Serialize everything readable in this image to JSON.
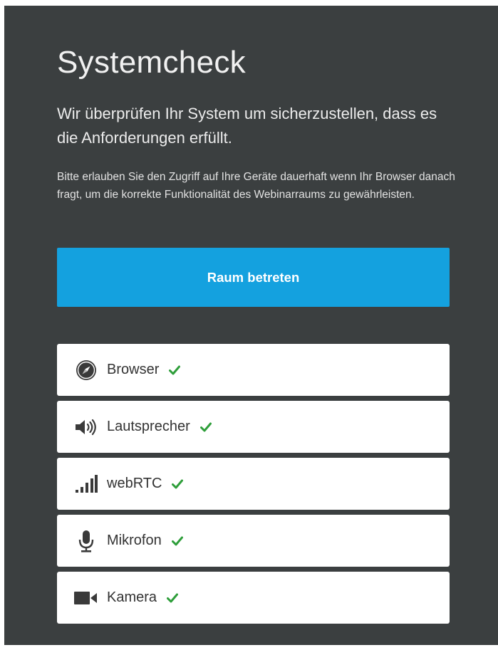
{
  "page": {
    "title": "Systemcheck",
    "subtitle": "Wir überprüfen Ihr System um sicherzustellen, dass es die Anforderungen erfüllt.",
    "note": "Bitte erlauben Sie den Zugriff auf Ihre Geräte dauerhaft wenn Ihr Browser danach fragt, um die korrekte Funktionalität des Webinarraums zu gewährleisten.",
    "enter_button": "Raum betreten"
  },
  "checks": [
    {
      "label": "Browser",
      "icon": "compass-icon",
      "status": "ok"
    },
    {
      "label": "Lautsprecher",
      "icon": "speaker-icon",
      "status": "ok"
    },
    {
      "label": "webRTC",
      "icon": "signal-bars-icon",
      "status": "ok"
    },
    {
      "label": "Mikrofon",
      "icon": "microphone-icon",
      "status": "ok"
    },
    {
      "label": "Kamera",
      "icon": "video-camera-icon",
      "status": "ok"
    }
  ],
  "colors": {
    "background": "#3b3f40",
    "button": "#14a1df",
    "check_ok": "#2e9e3a"
  }
}
